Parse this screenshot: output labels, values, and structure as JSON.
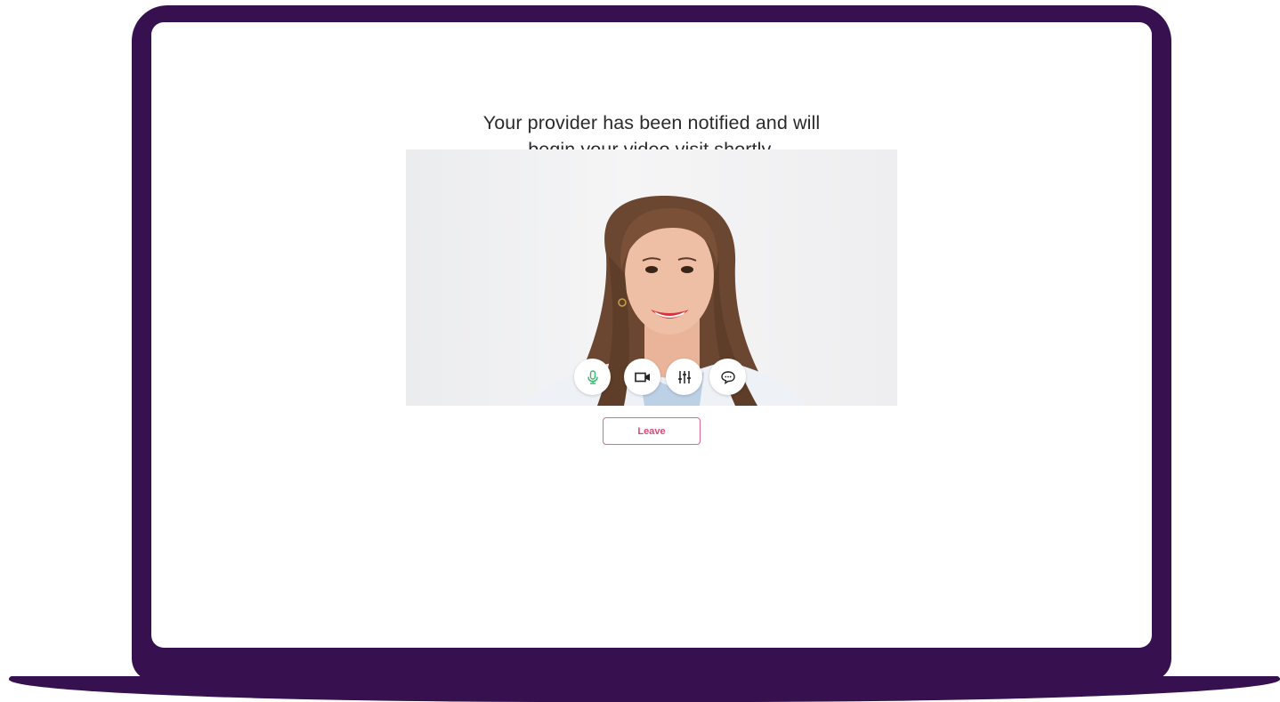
{
  "brand": {
    "frame_color": "#371050",
    "accent_pink": "#d9477c",
    "mic_green": "#3ab56e"
  },
  "waiting_room": {
    "message_line1": "Your provider has been notified and will",
    "message_line2": "begin your video visit shortly.",
    "leave_label": "Leave"
  },
  "video_controls": [
    {
      "name": "microphone",
      "icon": "microphone-icon",
      "state": "on"
    },
    {
      "name": "camera",
      "icon": "video-camera-icon"
    },
    {
      "name": "settings",
      "icon": "sliders-icon"
    },
    {
      "name": "chat",
      "icon": "chat-bubble-icon"
    }
  ]
}
